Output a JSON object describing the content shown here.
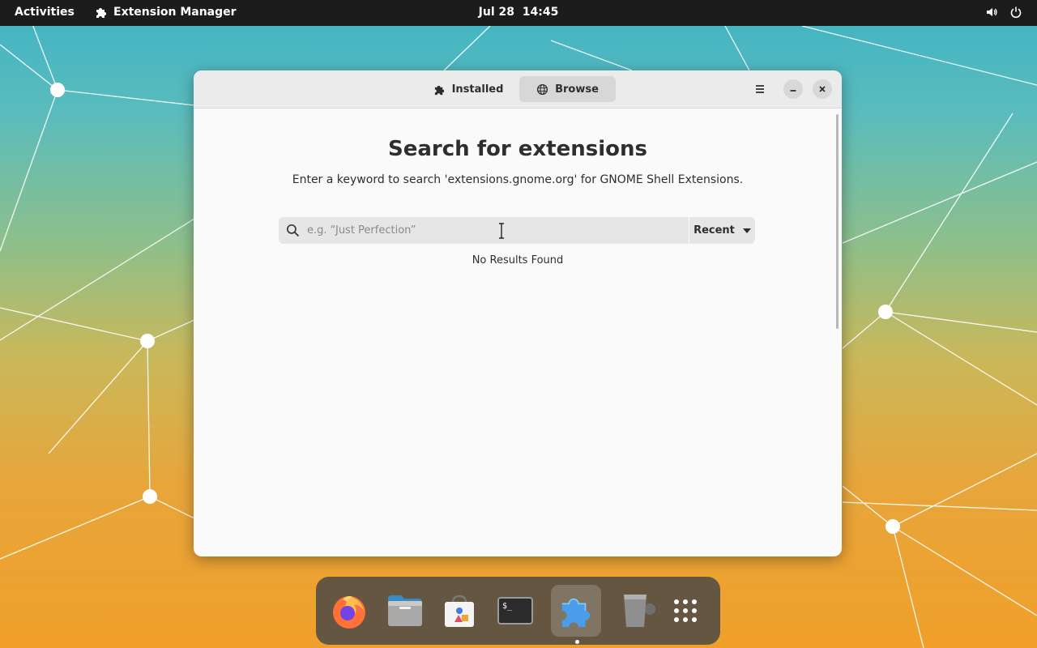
{
  "topbar": {
    "activities": "Activities",
    "app_name": "Extension Manager",
    "clock": "Jul 28  14:45",
    "icons": [
      "volume-icon",
      "power-icon"
    ]
  },
  "window": {
    "tabs": [
      {
        "label": "Installed",
        "icon": "puzzle-icon"
      },
      {
        "label": "Browse",
        "icon": "globe-icon",
        "selected": true
      }
    ],
    "title": "Search for extensions",
    "subtitle": "Enter a keyword to search 'extensions.gnome.org' for GNOME Shell Extensions.",
    "search": {
      "placeholder": "e.g. “Just Perfection”",
      "value": ""
    },
    "sort": {
      "label": "Recent"
    },
    "status": "No Results Found"
  },
  "dock": {
    "apps": [
      "Firefox",
      "Files",
      "Software",
      "Terminal",
      "Extension Manager",
      "Trash",
      "Show Applications"
    ],
    "running": "Extension Manager"
  },
  "colors": {
    "topbar": "#1c1c1c",
    "window_bg": "#fafafa",
    "headerbar": "#ebebeb",
    "accent_firefox": "#ff7139",
    "folder": "#7fb8d8"
  }
}
